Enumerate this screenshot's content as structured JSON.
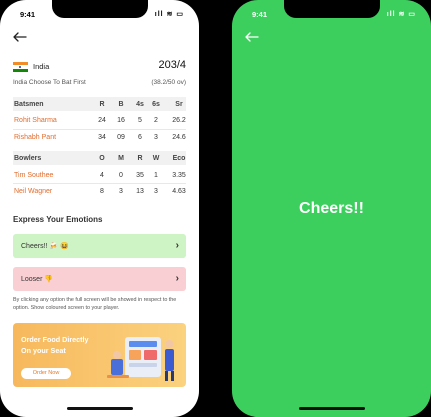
{
  "left_phone": {
    "status": {
      "time": "9:41",
      "icons": "ıll ≋ ▭"
    },
    "team": {
      "name": "India",
      "score": "203/4"
    },
    "toss": {
      "text": "India Choose To Bat First",
      "overs": "(38.2/50 ov)"
    },
    "batsmen": {
      "headers": [
        "Batsmen",
        "R",
        "B",
        "4s",
        "6s",
        "Sr"
      ],
      "rows": [
        [
          "Rohit Sharma",
          "24",
          "16",
          "5",
          "2",
          "26.2"
        ],
        [
          "Rishabh Pant",
          "34",
          "09",
          "6",
          "3",
          "24.6"
        ]
      ]
    },
    "bowlers": {
      "headers": [
        "Bowlers",
        "O",
        "M",
        "R",
        "W",
        "Eco"
      ],
      "rows": [
        [
          "Tim Southee",
          "4",
          "0",
          "35",
          "1",
          "3.35"
        ],
        [
          "Neil Wagner",
          "8",
          "3",
          "13",
          "3",
          "4.63"
        ]
      ]
    },
    "emotions": {
      "title": "Express Your Emotions",
      "cheers_label": "Cheers!! 🍻 😆",
      "looser_label": "Looser 👎",
      "note": "By clicking any option the full screen will be showed in respect to the option. Show coloured screen to your player."
    },
    "promo": {
      "line1": "Order Food Directly",
      "line2": "On your Seat",
      "button": "Order Now"
    }
  },
  "right_phone": {
    "status": {
      "time": "9:41",
      "icons": "ıll ≋ ▭"
    },
    "message": "Cheers!!"
  },
  "colors": {
    "cheers_green": "#3ccf5e",
    "accent_orange": "#e26d2e",
    "promo_orange": "#f7b85c"
  },
  "icons": [
    "back-arrow-icon",
    "chevron-right-icon",
    "india-flag-icon"
  ]
}
